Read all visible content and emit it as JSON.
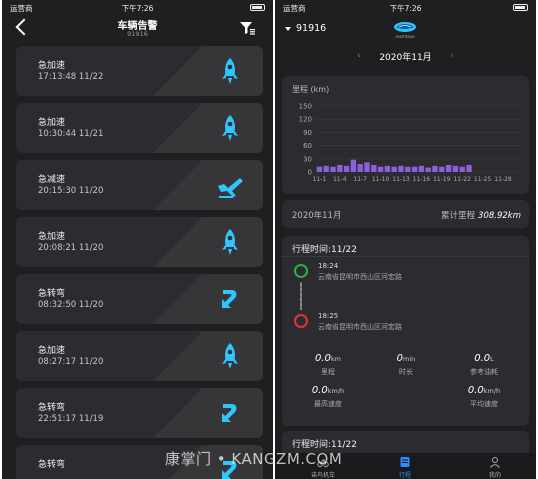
{
  "left": {
    "status": {
      "carrier": "运营商",
      "time": "下午7:26"
    },
    "header": {
      "title": "车辆告警",
      "subtitle": "91916"
    },
    "alerts": [
      {
        "type": "急加速",
        "time": "17:13:48 11/22",
        "icon": "rocket-icon"
      },
      {
        "type": "急加速",
        "time": "10:30:44 11/21",
        "icon": "rocket-icon"
      },
      {
        "type": "急减速",
        "time": "20:15:30 11/20",
        "icon": "plane-landing-icon"
      },
      {
        "type": "急加速",
        "time": "20:08:21 11/20",
        "icon": "rocket-icon"
      },
      {
        "type": "急转弯",
        "time": "08:32:50 11/20",
        "icon": "sharp-turn-icon"
      },
      {
        "type": "急加速",
        "time": "08:27:17 11/20",
        "icon": "rocket-icon"
      },
      {
        "type": "急转弯",
        "time": "22:51:17 11/19",
        "icon": "sharp-turn-icon"
      },
      {
        "type": "急转弯",
        "time": "",
        "icon": "sharp-turn-icon"
      }
    ]
  },
  "right": {
    "status": {
      "carrier": "运营商",
      "time": "下午7:26"
    },
    "header": {
      "plate": "91916",
      "logo_text": "roomtaxo"
    },
    "month_nav": {
      "prev": "‹",
      "month": "2020年11月",
      "next": "›"
    },
    "chart_data": {
      "type": "bar",
      "title": "",
      "ylabel": "里程 (km)",
      "xlabel": "",
      "ylim": [
        0,
        150
      ],
      "yticks": [
        0,
        30,
        60,
        90,
        120,
        150
      ],
      "grid": true,
      "bar_color": "#8a5fd8",
      "xtick_labels": [
        "11-1",
        "11-4",
        "11-7",
        "11-10",
        "11-13",
        "11-16",
        "11-19",
        "11-22",
        "11-25",
        "11-28"
      ],
      "categories": [
        "11-1",
        "11-2",
        "11-3",
        "11-4",
        "11-5",
        "11-6",
        "11-7",
        "11-8",
        "11-9",
        "11-10",
        "11-11",
        "11-12",
        "11-13",
        "11-14",
        "11-15",
        "11-16",
        "11-17",
        "11-18",
        "11-19",
        "11-20",
        "11-21",
        "11-22",
        "11-23",
        "11-24",
        "11-25",
        "11-26",
        "11-27",
        "11-28",
        "11-29",
        "11-30"
      ],
      "values": [
        12,
        14,
        12,
        16,
        14,
        28,
        18,
        22,
        16,
        12,
        14,
        12,
        14,
        12,
        12,
        14,
        10,
        14,
        12,
        16,
        14,
        12,
        16,
        0,
        0,
        0,
        0,
        0,
        0,
        0
      ]
    },
    "summary": {
      "month": "2020年11月",
      "total_label": "累计里程",
      "total_value": "308.92km"
    },
    "trip1": {
      "title": "行程时间:11/22",
      "start_time": "18:24",
      "start_addr": "云南省昆明市西山区河宏路",
      "end_time": "18:25",
      "end_addr": "云南省昆明市西山区河宏路",
      "stats": [
        {
          "num": "0.0",
          "unit": "km",
          "label": "里程"
        },
        {
          "num": "0",
          "unit": "min",
          "label": "时长"
        },
        {
          "num": "0.0",
          "unit": "L",
          "label": "参考油耗"
        },
        {
          "num": "0.0",
          "unit": "km/h",
          "label": "最高速度"
        },
        {
          "num": "0.0",
          "unit": "km/h",
          "label": "平均速度"
        }
      ]
    },
    "trip2": {
      "title": "行程时间:11/22"
    },
    "tabs": [
      {
        "label": "诺鸟机车",
        "icon": "motorbike-icon",
        "active": false
      },
      {
        "label": "行程",
        "icon": "trip-icon",
        "active": true
      },
      {
        "label": "我的",
        "icon": "user-icon",
        "active": false
      }
    ]
  },
  "watermark": "康掌门 • KANGZM.COM",
  "colors": {
    "accent": "#2ec6ff",
    "bar": "#8a5fd8",
    "start_dot": "#27b24a",
    "end_dot": "#e2333b",
    "tab_active": "#2a8cff"
  }
}
